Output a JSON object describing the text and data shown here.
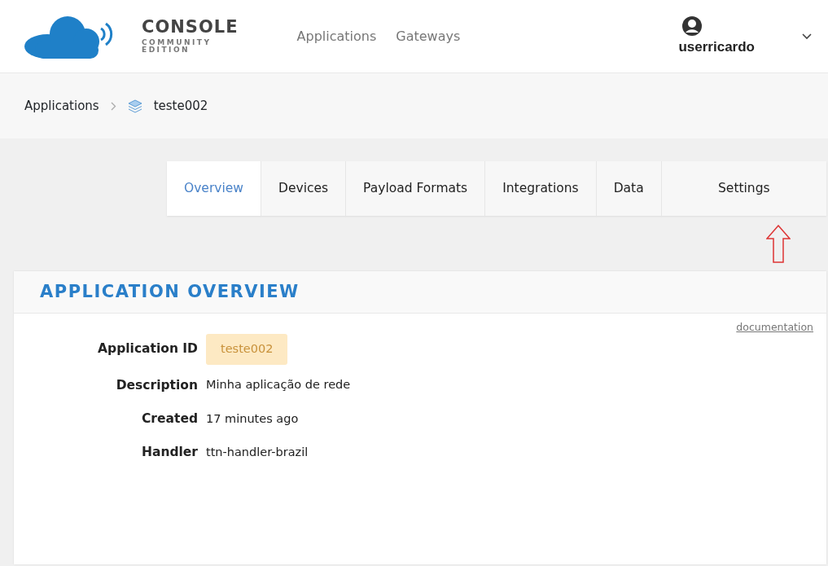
{
  "header": {
    "logo": {
      "title": "CONSOLE",
      "subtitle_1": "COMMUNITY",
      "subtitle_2": "EDITION"
    },
    "nav": [
      "Applications",
      "Gateways"
    ],
    "user": {
      "name": "userricardo"
    }
  },
  "breadcrumb": {
    "items": [
      "Applications",
      "teste002"
    ]
  },
  "tabs": [
    {
      "label": "Overview",
      "selected": true
    },
    {
      "label": "Devices",
      "selected": false
    },
    {
      "label": "Payload Formats",
      "selected": false
    },
    {
      "label": "Integrations",
      "selected": false
    },
    {
      "label": "Data",
      "selected": false
    },
    {
      "label": "Settings",
      "selected": false
    }
  ],
  "panel": {
    "title": "APPLICATION OVERVIEW",
    "link": "documentation",
    "fields": [
      {
        "label": "Application ID",
        "value": "teste002",
        "kind": "badge"
      },
      {
        "label": "Description",
        "value": "Minha aplicação de rede",
        "kind": "text"
      },
      {
        "label": "Created",
        "value": "17 minutes ago",
        "kind": "text"
      },
      {
        "label": "Handler",
        "value": "ttn-handler-brazil",
        "kind": "text"
      }
    ]
  }
}
